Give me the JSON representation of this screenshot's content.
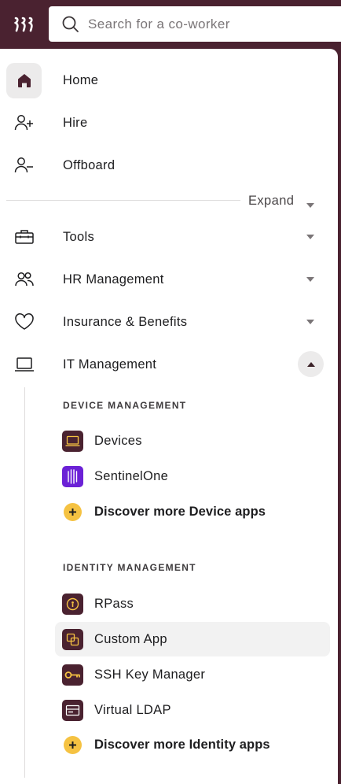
{
  "search": {
    "placeholder": "Search for a co-worker"
  },
  "nav": {
    "home": "Home",
    "hire": "Hire",
    "offboard": "Offboard",
    "expand": "Expand",
    "tools": "Tools",
    "hr": "HR Management",
    "insurance": "Insurance & Benefits",
    "it": "IT Management"
  },
  "it_menu": {
    "device_section": "DEVICE MANAGEMENT",
    "identity_section": "IDENTITY MANAGEMENT",
    "devices": "Devices",
    "sentinelone": "SentinelOne",
    "discover_device": "Discover more Device apps",
    "rpass": "RPass",
    "custom_app": "Custom App",
    "ssh_key": "SSH Key Manager",
    "virtual_ldap": "Virtual LDAP",
    "discover_identity": "Discover more Identity apps"
  },
  "colors": {
    "brand": "#4a2230",
    "app_icon_bg": "#4a2230",
    "sentinel_bg": "#6b21d6",
    "accent_yellow": "#f5c242"
  }
}
